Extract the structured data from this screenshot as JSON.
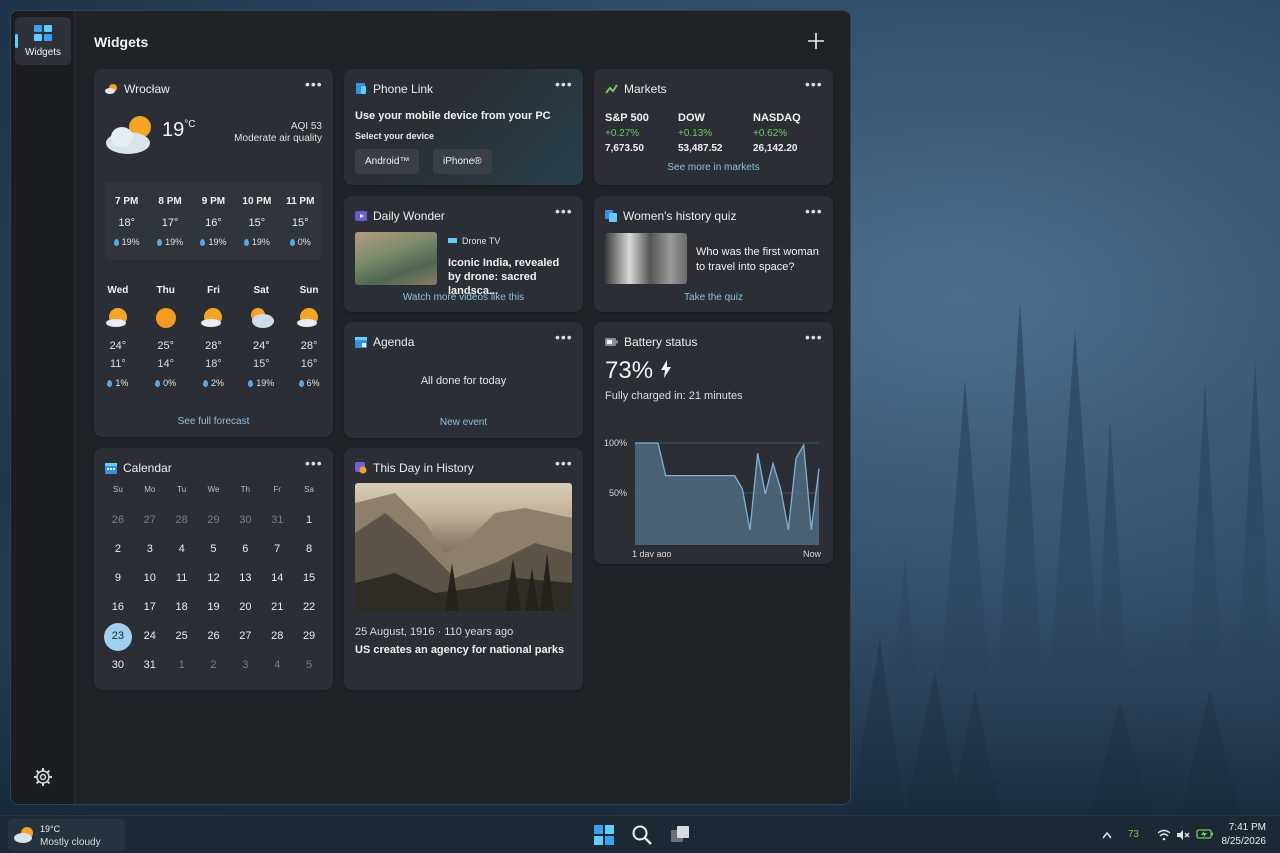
{
  "panel": {
    "title": "Widgets",
    "rail_label": "Widgets"
  },
  "weather": {
    "location": "Wrocław",
    "temp": "19",
    "unit": "°C",
    "aqi": "AQI 53",
    "aqi_text": "Moderate air quality",
    "hourly": [
      {
        "time": "7 PM",
        "temp": "18°",
        "rain": "19%"
      },
      {
        "time": "8 PM",
        "temp": "17°",
        "rain": "19%"
      },
      {
        "time": "9 PM",
        "temp": "16°",
        "rain": "19%"
      },
      {
        "time": "10 PM",
        "temp": "15°",
        "rain": "19%"
      },
      {
        "time": "11 PM",
        "temp": "15°",
        "rain": "0%"
      }
    ],
    "daily": [
      {
        "day": "Wed",
        "icon": "partly-sunny-icon",
        "high": "24°",
        "low": "11°",
        "rain": "1%"
      },
      {
        "day": "Thu",
        "icon": "sunny-icon",
        "high": "25°",
        "low": "14°",
        "rain": "0%"
      },
      {
        "day": "Fri",
        "icon": "partly-sunny-icon",
        "high": "28°",
        "low": "18°",
        "rain": "2%"
      },
      {
        "day": "Sat",
        "icon": "partly-cloudy-icon",
        "high": "24°",
        "low": "15°",
        "rain": "19%"
      },
      {
        "day": "Sun",
        "icon": "partly-sunny-icon",
        "high": "28°",
        "low": "16°",
        "rain": "6%"
      }
    ],
    "link": "See full forecast"
  },
  "phone_link": {
    "title": "Phone Link",
    "heading": "Use your mobile device from your PC",
    "subheading": "Select your device",
    "buttons": [
      "Android™",
      "iPhone®"
    ]
  },
  "markets": {
    "title": "Markets",
    "items": [
      {
        "name": "S&P 500",
        "change": "+0.27%",
        "value": "7,673.50"
      },
      {
        "name": "DOW",
        "change": "+0.13%",
        "value": "53,487.52"
      },
      {
        "name": "NASDAQ",
        "change": "+0.62%",
        "value": "26,142.20"
      }
    ],
    "link": "See more in markets"
  },
  "daily_wonder": {
    "title": "Daily Wonder",
    "source": "Drone TV",
    "headline": "Iconic India, revealed by drone: sacred landsca...",
    "link": "Watch more videos like this"
  },
  "quiz": {
    "title": "Women's history quiz",
    "question": "Who was the first woman to travel into space?",
    "link": "Take the quiz"
  },
  "agenda": {
    "title": "Agenda",
    "status": "All done for today",
    "link": "New event"
  },
  "battery": {
    "title": "Battery status",
    "percent": "73%",
    "subtitle": "Fully charged in: 21 minutes",
    "y_labels": [
      "100%",
      "50%"
    ],
    "x_labels": [
      "1 day ago",
      "Now"
    ]
  },
  "chart_data": {
    "type": "area",
    "title": "",
    "xlabel": "",
    "ylabel": "",
    "ylim": [
      0,
      100
    ],
    "x_tick_labels": [
      "1 day ago",
      "Now"
    ],
    "y_tick_labels": [
      "100%",
      "50%"
    ],
    "grid": true,
    "values": [
      100,
      100,
      100,
      100,
      68,
      68,
      68,
      68,
      68,
      68,
      68,
      68,
      68,
      68,
      55,
      15,
      90,
      50,
      80,
      55,
      15,
      85,
      98,
      15,
      75
    ]
  },
  "calendar": {
    "title": "Calendar",
    "weekdays": [
      "Su",
      "Mo",
      "Tu",
      "We",
      "Th",
      "Fr",
      "Sa"
    ],
    "days": [
      {
        "n": "26",
        "dim": true
      },
      {
        "n": "27",
        "dim": true
      },
      {
        "n": "28",
        "dim": true
      },
      {
        "n": "29",
        "dim": true
      },
      {
        "n": "30",
        "dim": true
      },
      {
        "n": "31",
        "dim": true
      },
      {
        "n": "1"
      },
      {
        "n": "2"
      },
      {
        "n": "3"
      },
      {
        "n": "4"
      },
      {
        "n": "5"
      },
      {
        "n": "6"
      },
      {
        "n": "7"
      },
      {
        "n": "8"
      },
      {
        "n": "9"
      },
      {
        "n": "10"
      },
      {
        "n": "11"
      },
      {
        "n": "12"
      },
      {
        "n": "13"
      },
      {
        "n": "14"
      },
      {
        "n": "15"
      },
      {
        "n": "16"
      },
      {
        "n": "17"
      },
      {
        "n": "18"
      },
      {
        "n": "19"
      },
      {
        "n": "20"
      },
      {
        "n": "21"
      },
      {
        "n": "22"
      },
      {
        "n": "23",
        "today": true
      },
      {
        "n": "24"
      },
      {
        "n": "25"
      },
      {
        "n": "26"
      },
      {
        "n": "27"
      },
      {
        "n": "28"
      },
      {
        "n": "29"
      },
      {
        "n": "30"
      },
      {
        "n": "31"
      },
      {
        "n": "1",
        "dim": true
      },
      {
        "n": "2",
        "dim": true
      },
      {
        "n": "3",
        "dim": true
      },
      {
        "n": "4",
        "dim": true
      },
      {
        "n": "5",
        "dim": true
      }
    ]
  },
  "history": {
    "title": "This Day in History",
    "date": "25 August, 1916 · 110 years ago",
    "headline": "US creates an agency for national parks"
  },
  "taskbar": {
    "weather_temp": "19°C",
    "weather_desc": "Mostly cloudy",
    "tray_count": "73",
    "time": "7:41 PM",
    "date": "8/25/2026"
  },
  "colors": {
    "accent": "#60cdff",
    "positive": "#6ccb5f",
    "link": "#8fc0dc",
    "card": "#2b2f35",
    "panel": "#1f2328"
  }
}
